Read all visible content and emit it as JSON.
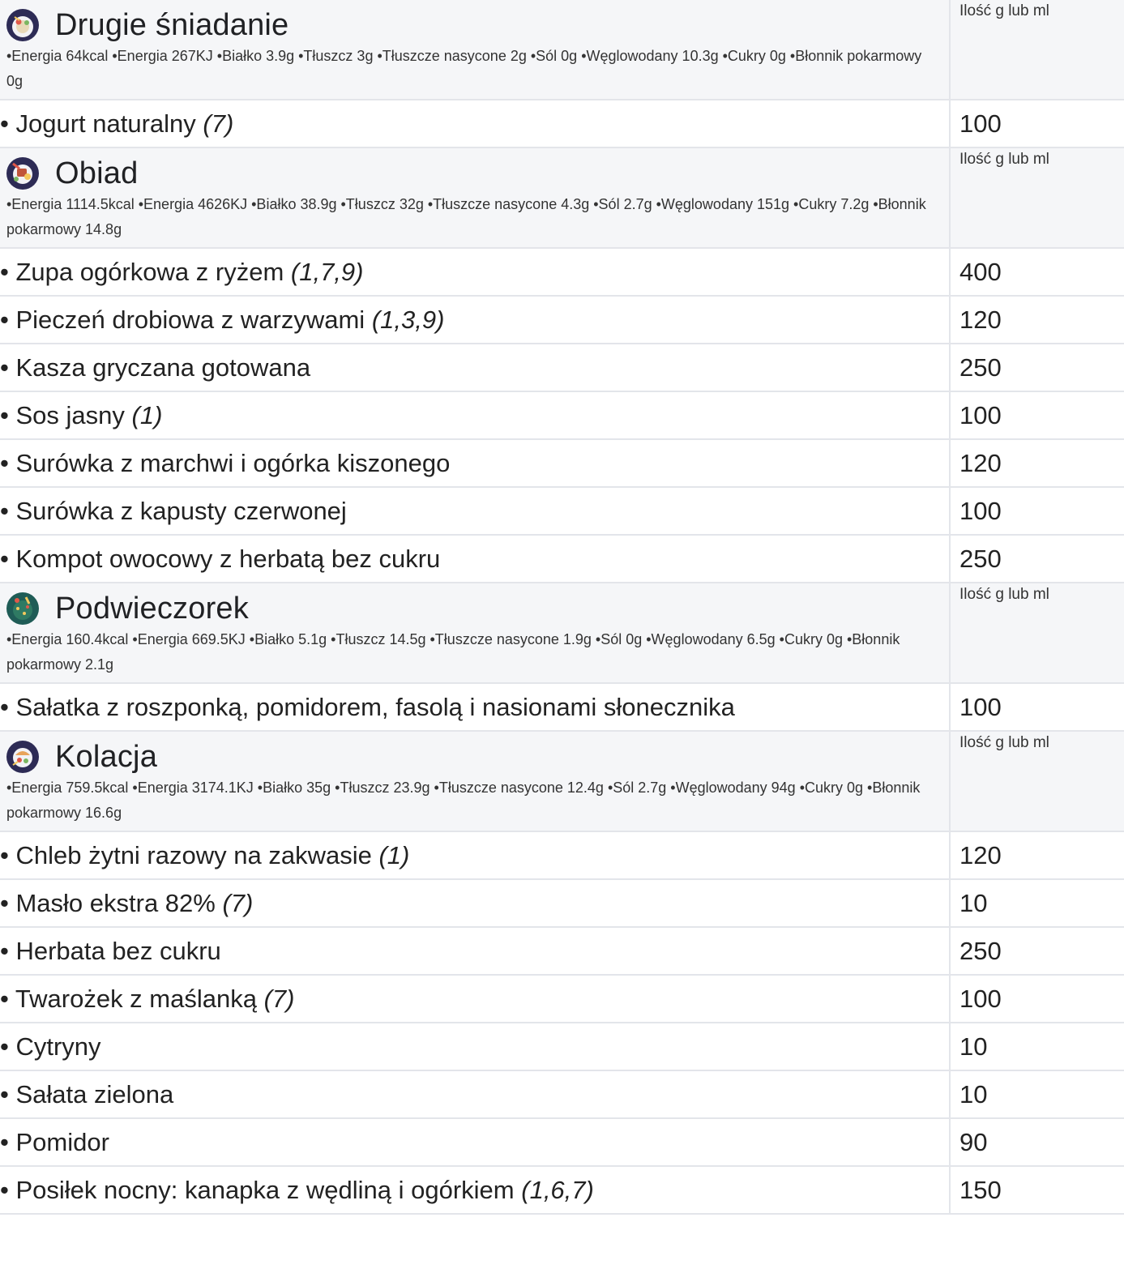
{
  "qty_header": "Ilość g lub ml",
  "meals": [
    {
      "title": "Drugie śniadanie",
      "icon": "breakfast-plate-icon",
      "nutrition": "•Energia 64kcal •Energia 267KJ •Białko 3.9g •Tłuszcz 3g •Tłuszcze nasycone 2g •Sól 0g •Węglowodany 10.3g •Cukry 0g •Błonnik pokarmowy 0g",
      "items": [
        {
          "name": "• Jogurt naturalny",
          "allergens": "(7)",
          "qty": "100"
        }
      ]
    },
    {
      "title": "Obiad",
      "icon": "lunch-plate-icon",
      "nutrition": "•Energia 1114.5kcal •Energia 4626KJ •Białko 38.9g •Tłuszcz 32g •Tłuszcze nasycone 4.3g •Sól 2.7g •Węglowodany 151g •Cukry 7.2g •Błonnik pokarmowy 14.8g",
      "items": [
        {
          "name": "• Zupa ogórkowa z ryżem",
          "allergens": "(1,7,9)",
          "qty": "400"
        },
        {
          "name": "• Pieczeń drobiowa z warzywami",
          "allergens": "(1,3,9)",
          "qty": "120"
        },
        {
          "name": "• Kasza gryczana gotowana",
          "allergens": "",
          "qty": "250"
        },
        {
          "name": "• Sos jasny",
          "allergens": "(1)",
          "qty": "100"
        },
        {
          "name": "• Surówka z marchwi i ogórka kiszonego",
          "allergens": "",
          "qty": "120"
        },
        {
          "name": "• Surówka z kapusty czerwonej",
          "allergens": "",
          "qty": "100"
        },
        {
          "name": "• Kompot owocowy z herbatą bez cukru",
          "allergens": "",
          "qty": "250"
        }
      ]
    },
    {
      "title": "Podwieczorek",
      "icon": "snack-plate-icon",
      "nutrition": "•Energia 160.4kcal •Energia 669.5KJ •Białko 5.1g •Tłuszcz 14.5g •Tłuszcze nasycone 1.9g •Sól 0g •Węglowodany 6.5g •Cukry 0g •Błonnik pokarmowy 2.1g",
      "items": [
        {
          "name": "• Sałatka z roszponką, pomidorem, fasolą i nasionami słonecznika",
          "allergens": "",
          "qty": "100"
        }
      ]
    },
    {
      "title": "Kolacja",
      "icon": "dinner-plate-icon",
      "nutrition": "•Energia 759.5kcal •Energia 3174.1KJ •Białko 35g •Tłuszcz 23.9g •Tłuszcze nasycone 12.4g •Sól 2.7g •Węglowodany 94g •Cukry 0g •Błonnik pokarmowy 16.6g",
      "items": [
        {
          "name": "• Chleb żytni razowy na zakwasie",
          "allergens": "(1)",
          "qty": "120"
        },
        {
          "name": "• Masło ekstra 82%",
          "allergens": "(7)",
          "qty": "10"
        },
        {
          "name": "• Herbata bez cukru",
          "allergens": "",
          "qty": "250"
        },
        {
          "name": "• Twarożek z maślanką",
          "allergens": "(7)",
          "qty": "100"
        },
        {
          "name": "• Cytryny",
          "allergens": "",
          "qty": "10"
        },
        {
          "name": "• Sałata zielona",
          "allergens": "",
          "qty": "10"
        },
        {
          "name": "• Pomidor",
          "allergens": "",
          "qty": "90"
        },
        {
          "name": "• Posiłek nocny: kanapka z wędliną i ogórkiem",
          "allergens": "(1,6,7)",
          "qty": "150"
        }
      ]
    }
  ]
}
